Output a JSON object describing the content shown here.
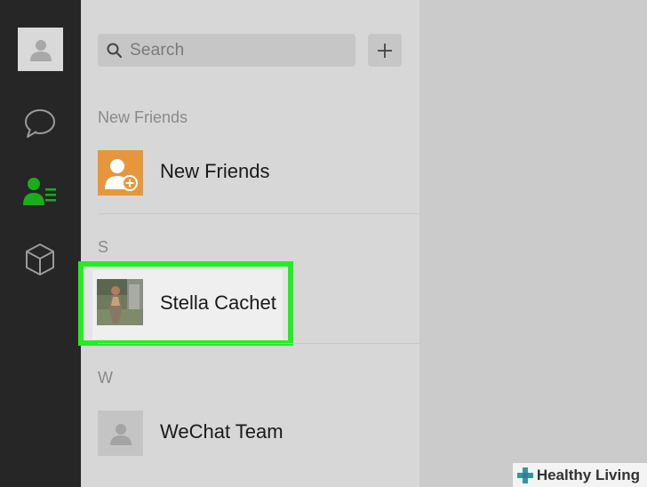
{
  "search": {
    "placeholder": "Search"
  },
  "sections": {
    "new_friends": "New Friends",
    "s": "S",
    "w": "W"
  },
  "contacts": [
    {
      "name": "New Friends",
      "icon": "add-friend-icon"
    },
    {
      "name": "Stella Cachet",
      "icon": "photo-avatar"
    },
    {
      "name": "WeChat Team",
      "icon": "default-avatar-icon"
    }
  ],
  "colors": {
    "active_icon": "#1aad19",
    "highlight": "#22ee22",
    "new_friends_avatar": "#e6963c"
  },
  "watermark": "Healthy Living"
}
